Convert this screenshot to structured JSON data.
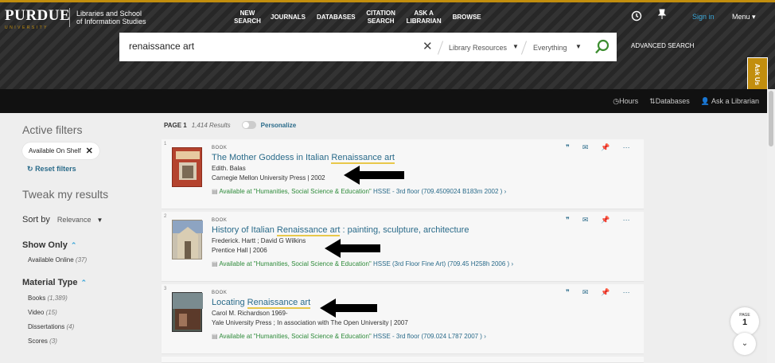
{
  "header": {
    "logo": "PURDUE",
    "logo_sub": "UNIVERSITY",
    "school": "Libraries and School of Information Studies",
    "nav": [
      "NEW SEARCH",
      "JOURNALS",
      "DATABASES",
      "CITATION SEARCH",
      "ASK A LIBRARIAN",
      "BROWSE"
    ],
    "sign_in": "Sign in",
    "menu": "Menu",
    "accent_color": "#c28e0e"
  },
  "search": {
    "query": "renaissance art",
    "scope": "Library Resources",
    "type": "Everything",
    "advanced": "ADVANCED SEARCH"
  },
  "ask_us": "Ask Us",
  "subbar": {
    "hours": "Hours",
    "databases": "Databases",
    "ask_librarian": "Ask a Librarian"
  },
  "sidebar": {
    "active_filters": "Active filters",
    "active_chip": "Available On Shelf",
    "reset": "Reset filters",
    "tweak": "Tweak my results",
    "sort_label": "Sort by",
    "sort_value": "Relevance",
    "show_only": "Show Only",
    "show_only_items": [
      {
        "label": "Available Online",
        "count": "(37)"
      }
    ],
    "material_type": "Material Type",
    "material_items": [
      {
        "label": "Books",
        "count": "(1,389)"
      },
      {
        "label": "Video",
        "count": "(15)"
      },
      {
        "label": "Dissertations",
        "count": "(4)"
      },
      {
        "label": "Scores",
        "count": "(3)"
      }
    ]
  },
  "results_meta": {
    "page": "PAGE 1",
    "count": "1,414 Results",
    "personalize": "Personalize"
  },
  "results": [
    {
      "num": "1",
      "type": "BOOK",
      "title_pre": "The Mother Goddess in Italian ",
      "title_hl": "Renaissance art",
      "title_post": "",
      "author": "Edith. Balas",
      "publisher": "Carnegie Mellon University Press | 2002",
      "avail": "Available at \"Humanities, Social Science & Education\"",
      "location": "HSSE - 3rd floor (709.4509024 B183m 2002 )"
    },
    {
      "num": "2",
      "type": "BOOK",
      "title_pre": "History of Italian ",
      "title_hl": "Renaissance art",
      "title_post": " : painting, sculpture, architecture",
      "author": "Frederick. Hartt ; David G Wilkins",
      "publisher": "Prentice Hall | 2006",
      "avail": "Available at \"Humanities, Social Science & Education\"",
      "location": "HSSE (3rd Floor Fine Art) (709.45 H258h 2006 )"
    },
    {
      "num": "3",
      "type": "BOOK",
      "title_pre": "Locating ",
      "title_hl": "Renaissance art",
      "title_post": "",
      "author": "Carol M. Richardson 1969-",
      "publisher": "Yale University Press ; In association with The Open University | 2007",
      "avail": "Available at \"Humanities, Social Science & Education\"",
      "location": "HSSE - 3rd floor (709.024 L787 2007 )"
    }
  ],
  "page_bubble": {
    "label": "PAGE",
    "num": "1"
  }
}
